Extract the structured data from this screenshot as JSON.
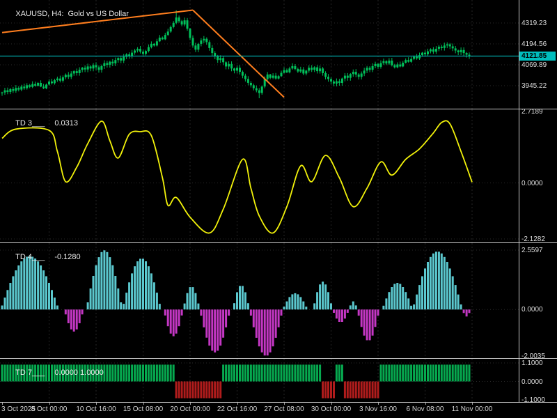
{
  "colors": {
    "background": "#000000",
    "grid": "#262626",
    "grid_h": "#2a2a2a",
    "candle": "#00c05a",
    "trend": "#ff7e1e",
    "price_line": "#00aaaa",
    "badge_bg": "#00bdbd",
    "badge_text": "#000000",
    "td3_line": "#f2f20a",
    "td4_pos": "#5bc8ce",
    "td4_neg": "#c437c4",
    "td7_pos": "#06a94f",
    "td7_neg": "#b01c1c",
    "axis_text": "#dedede",
    "panel_border": "#c9c9c9"
  },
  "panels": {
    "price": {
      "title": "XAUUSD, H4:  Gold vs US Dollar",
      "axis_labels": [
        {
          "text": "4319.23",
          "value": 4319.23
        },
        {
          "text": "4194.56",
          "value": 4194.56
        },
        {
          "text": "4069.89",
          "value": 4069.89
        },
        {
          "text": "3945.22",
          "value": 3945.22
        }
      ],
      "current_price": {
        "text": "4121.85",
        "value": 4121.85
      }
    },
    "td3": {
      "name": "TD 3___",
      "value_text": "0.0313",
      "axis_labels": [
        {
          "text": "2.7189",
          "value": 2.7189
        },
        {
          "text": "0.0000",
          "value": 0
        },
        {
          "text": "-2.1282",
          "value": -2.1282
        }
      ]
    },
    "td4": {
      "name": "TD 4___",
      "value_text": "-0.1280",
      "axis_labels": [
        {
          "text": "2.5597",
          "value": 2.5597
        },
        {
          "text": "0.0000",
          "value": 0
        },
        {
          "text": "-2.0035",
          "value": -2.0035
        }
      ]
    },
    "td7": {
      "name": "TD 7___",
      "value_text": "0.0000 1.0000",
      "axis_labels": [
        {
          "text": "1.1000",
          "value": 1.1
        },
        {
          "text": "0.0000",
          "value": 0
        },
        {
          "text": "-1.1000",
          "value": -1.1
        }
      ]
    }
  },
  "time_axis": [
    {
      "text": "3 Oct 2025",
      "bar": 0
    },
    {
      "text": "8 Oct 00:00",
      "bar": 17
    },
    {
      "text": "10 Oct 16:00",
      "bar": 34
    },
    {
      "text": "15 Oct 08:00",
      "bar": 51
    },
    {
      "text": "20 Oct 00:00",
      "bar": 68
    },
    {
      "text": "22 Oct 16:00",
      "bar": 85
    },
    {
      "text": "27 Oct 08:00",
      "bar": 102
    },
    {
      "text": "30 Oct 00:00",
      "bar": 119
    },
    {
      "text": "3 Nov 16:00",
      "bar": 136
    },
    {
      "text": "6 Nov 08:00",
      "bar": 153
    },
    {
      "text": "11 Nov 00:00",
      "bar": 170
    }
  ],
  "chart_data": [
    {
      "type": "candlestick",
      "symbol": "XAUUSD",
      "timeframe": "H4",
      "title": "Gold vs US Dollar",
      "bars": 170,
      "open_first": 3900,
      "closes": [
        3905,
        3918,
        3908,
        3925,
        3915,
        3932,
        3922,
        3940,
        3930,
        3948,
        3938,
        3955,
        3945,
        3962,
        3940,
        3930,
        3952,
        3970,
        3960,
        3978,
        3988,
        3975,
        3995,
        4010,
        3998,
        4018,
        4032,
        4020,
        4040,
        4052,
        4042,
        4060,
        4048,
        4068,
        4055,
        4040,
        4062,
        4080,
        4070,
        4088,
        4078,
        4098,
        4110,
        4095,
        4118,
        4132,
        4120,
        4142,
        4155,
        4165,
        4148,
        4135,
        4152,
        4175,
        4195,
        4185,
        4210,
        4232,
        4222,
        4248,
        4268,
        4295,
        4320,
        4352,
        4330,
        4310,
        4335,
        4285,
        4230,
        4185,
        4160,
        4195,
        4215,
        4225,
        4205,
        4170,
        4140,
        4120,
        4098,
        4110,
        4085,
        4060,
        4075,
        4048,
        4035,
        4052,
        4028,
        4005,
        3985,
        3962,
        3948,
        3930,
        3918,
        3902,
        3940,
        3985,
        4012,
        3992,
        4005,
        3988,
        4002,
        4022,
        4038,
        4025,
        4048,
        4062,
        4045,
        4030,
        4042,
        4018,
        4035,
        4052,
        4040,
        4055,
        4032,
        4048,
        4020,
        3998,
        3985,
        3970,
        3958,
        3972,
        3962,
        3988,
        4005,
        3992,
        4015,
        4028,
        4012,
        3998,
        4018,
        4035,
        4052,
        4040,
        4062,
        4075,
        4058,
        4080,
        4092,
        4078,
        4095,
        4068,
        4055,
        4072,
        4060,
        4082,
        4098,
        4088,
        4105,
        4118,
        4108,
        4128,
        4142,
        4132,
        4150,
        4162,
        4148,
        4165,
        4178,
        4170,
        4185,
        4192,
        4180,
        4168,
        4155,
        4145,
        4158,
        4140,
        4130,
        4122
      ],
      "current_price": 4121.85,
      "ylim": [
        3870,
        4456
      ],
      "trendlines": [
        {
          "from_bar": 0,
          "from_price": 4262,
          "to_bar": 69,
          "to_price": 4396
        },
        {
          "from_bar": 69,
          "from_price": 4396,
          "to_bar": 102,
          "to_price": 3876
        }
      ]
    },
    {
      "type": "line",
      "name": "TD 3___",
      "last_value": 0.0313,
      "ylim": [
        -2.1282,
        2.7189
      ],
      "points": [
        [
          0,
          1.7
        ],
        [
          5,
          2.05
        ],
        [
          17,
          2.0
        ],
        [
          20,
          1.2
        ],
        [
          23,
          0.05
        ],
        [
          27,
          0.6
        ],
        [
          31,
          1.5
        ],
        [
          36,
          2.35
        ],
        [
          39,
          1.6
        ],
        [
          42,
          0.95
        ],
        [
          46,
          1.85
        ],
        [
          50,
          1.95
        ],
        [
          54,
          1.8
        ],
        [
          58,
          0.2
        ],
        [
          60,
          -0.85
        ],
        [
          63,
          -0.55
        ],
        [
          68,
          -1.3
        ],
        [
          75,
          -1.9
        ],
        [
          80,
          -1.0
        ],
        [
          87,
          0.9
        ],
        [
          90,
          -0.2
        ],
        [
          93,
          -1.25
        ],
        [
          98,
          -1.9
        ],
        [
          103,
          -0.9
        ],
        [
          108,
          0.65
        ],
        [
          112,
          0.05
        ],
        [
          117,
          1.05
        ],
        [
          122,
          0.2
        ],
        [
          127,
          -0.9
        ],
        [
          132,
          -0.2
        ],
        [
          137,
          0.8
        ],
        [
          141,
          0.3
        ],
        [
          146,
          0.9
        ],
        [
          151,
          1.3
        ],
        [
          156,
          1.9
        ],
        [
          159,
          2.3
        ],
        [
          162,
          2.25
        ],
        [
          166,
          1.2
        ],
        [
          170,
          0.0313
        ]
      ]
    },
    {
      "type": "bar",
      "name": "TD 4___",
      "last_value": -0.128,
      "ylim": [
        -2.0035,
        2.5597
      ],
      "groups": [
        [
          0,
          20,
          2.3
        ],
        [
          23,
          29,
          -0.95
        ],
        [
          31,
          43,
          2.55
        ],
        [
          44,
          57,
          2.2
        ],
        [
          59,
          65,
          -1.15
        ],
        [
          66,
          71,
          1.0
        ],
        [
          72,
          82,
          -1.85
        ],
        [
          84,
          89,
          1.05
        ],
        [
          90,
          101,
          -2.0
        ],
        [
          102,
          110,
          0.7
        ],
        [
          113,
          119,
          1.2
        ],
        [
          120,
          125,
          -0.55
        ],
        [
          126,
          128,
          0.35
        ],
        [
          129,
          136,
          -1.35
        ],
        [
          138,
          148,
          1.15
        ],
        [
          149,
          166,
          2.5
        ],
        [
          167,
          169,
          -0.3
        ]
      ]
    },
    {
      "type": "bar",
      "name": "TD 7___",
      "last_values": [
        0.0,
        1.0
      ],
      "ylim": [
        -1.1,
        1.1
      ],
      "segments": [
        [
          0,
          62,
          1
        ],
        [
          63,
          79,
          -1
        ],
        [
          80,
          115,
          1
        ],
        [
          116,
          120,
          -1
        ],
        [
          121,
          123,
          1
        ],
        [
          124,
          136,
          -1
        ],
        [
          137,
          169,
          1
        ]
      ]
    }
  ]
}
